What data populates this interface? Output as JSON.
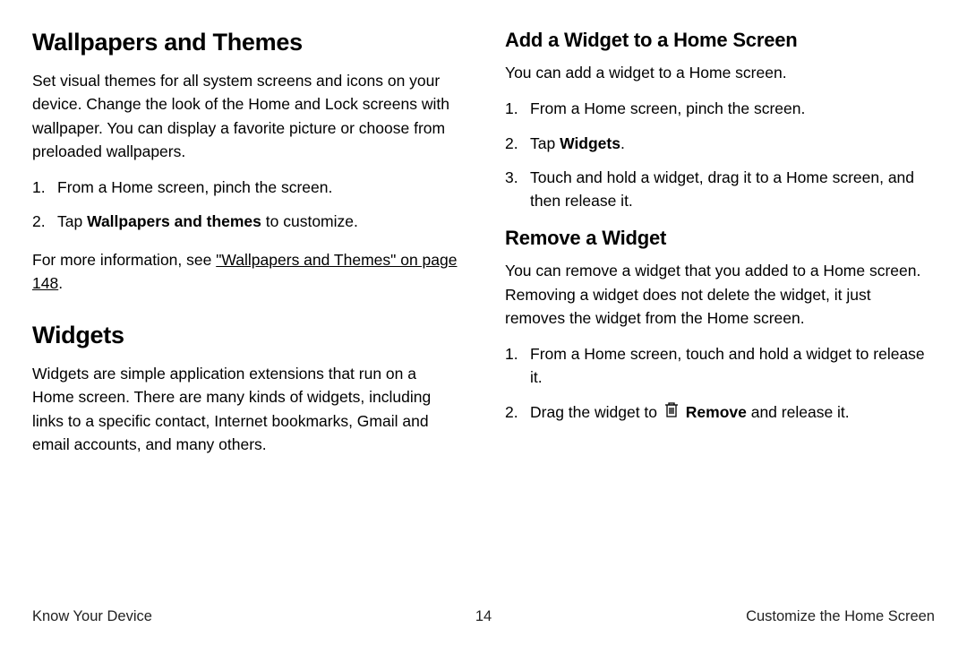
{
  "left": {
    "h1a": "Wallpapers and Themes",
    "p1": "Set visual themes for all system screens and icons on your device. Change the look of the Home and Lock screens with wallpaper. You can display a favorite picture or choose from preloaded wallpapers.",
    "step1": "From a Home screen, pinch the screen.",
    "step2_pre": "Tap ",
    "step2_bold": "Wallpapers and themes",
    "step2_post": " to customize.",
    "more_pre": "For more information, see ",
    "more_link": "\"Wallpapers and Themes\" on page 148",
    "more_post": ".",
    "h1b": "Widgets",
    "p2": "Widgets are simple application extensions that run on a Home screen. There are many kinds of widgets, including links to a specific contact, Internet bookmarks, Gmail and email accounts, and many others."
  },
  "right": {
    "h2a": "Add a Widget to a Home Screen",
    "p1": "You can add a widget to a Home screen.",
    "a_step1": "From a Home screen, pinch the screen.",
    "a_step2_pre": "Tap ",
    "a_step2_bold": "Widgets",
    "a_step2_post": ".",
    "a_step3": "Touch and hold a widget, drag it to a Home screen, and then release it.",
    "h2b": "Remove a Widget",
    "p2": "You can remove a widget that you added to a Home screen. Removing a widget does not delete the widget, it just removes the widget from the Home screen.",
    "b_step1": "From a Home screen, touch and hold a widget to release it.",
    "b_step2_pre": "Drag the widget to ",
    "b_step2_bold": "Remove",
    "b_step2_post": " and release it."
  },
  "footer": {
    "left": "Know Your Device",
    "center": "14",
    "right": "Customize the Home Screen"
  }
}
